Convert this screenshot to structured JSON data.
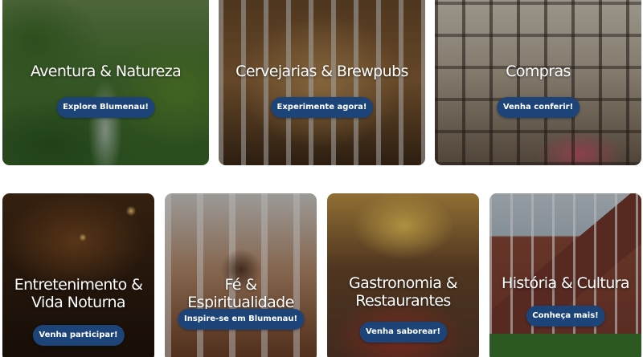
{
  "cards": [
    {
      "title": "Aventura & Natureza",
      "cta": "Explore Blumenau!"
    },
    {
      "title": "Cervejarias & Brewpubs",
      "cta": "Experimente agora!"
    },
    {
      "title": "Compras",
      "cta": "Venha conferir!"
    },
    {
      "title": "Entretenimento & Vida Noturna",
      "cta": "Venha participar!"
    },
    {
      "title": "Fé & Espiritualidade",
      "cta": "Inspire-se em Blumenau!"
    },
    {
      "title": "Gastronomia & Restaurantes",
      "cta": "Venha saborear!"
    },
    {
      "title": "História & Cultura",
      "cta": "Conheça mais!"
    }
  ],
  "colors": {
    "cta_background": "#1d4478",
    "title_text": "#ffffff"
  }
}
